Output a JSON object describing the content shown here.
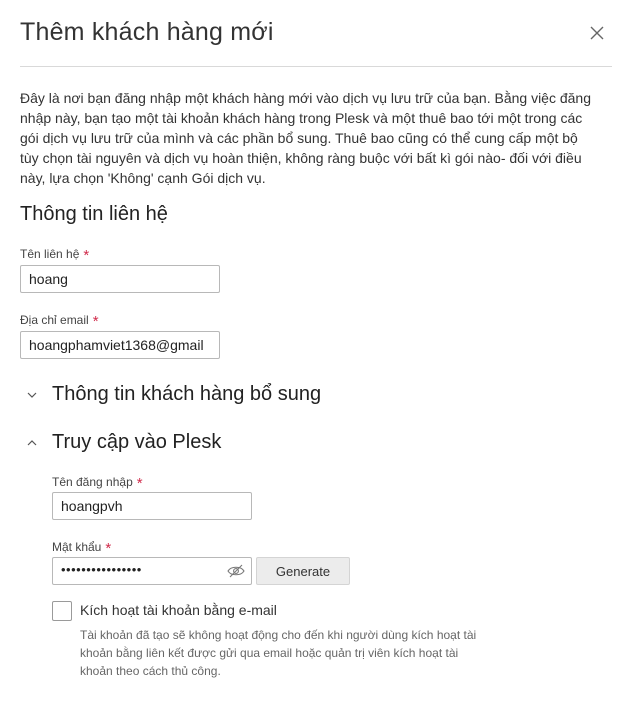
{
  "dialog": {
    "title": "Thêm khách hàng mới",
    "intro": "Đây là nơi bạn đăng nhập một khách hàng mới vào dịch vụ lưu trữ của bạn. Bằng việc đăng nhập này, bạn tạo một tài khoản khách hàng trong Plesk và một thuê bao tới một trong các gói dịch vụ lưu trữ của mình và các phần bổ sung. Thuê bao cũng có thể cung cấp một bộ tùy chọn tài nguyên và dịch vụ hoàn thiện, không ràng buộc với bất kì gói nào- đối với điều này, lựa chọn 'Không' cạnh Gói dịch vụ."
  },
  "contact": {
    "heading": "Thông tin liên hệ",
    "name_label": "Tên liên hệ",
    "name_value": "hoang",
    "email_label": "Địa chỉ email",
    "email_value": "hoangphamviet1368@gmail"
  },
  "additional_info": {
    "label": "Thông tin khách hàng bổ sung",
    "expanded": false
  },
  "plesk_access": {
    "label": "Truy cập vào Plesk",
    "expanded": true,
    "username_label": "Tên đăng nhập",
    "username_value": "hoangpvh",
    "password_label": "Mật khẩu",
    "password_masked": "••••••••••••••••",
    "generate_label": "Generate",
    "activate_label": "Kích hoạt tài khoản bằng e-mail",
    "activate_checked": false,
    "activate_hint": "Tài khoản đã tạo sẽ không hoạt động cho đến khi người dùng kích hoạt tài khoản bằng liên kết được gửi qua email hoặc quản trị viên kích hoạt tài khoản theo cách thủ công."
  },
  "required_marker": "*",
  "icons": {
    "close": "close-icon",
    "chevron_collapsed": "chevron-down-icon",
    "chevron_expanded": "chevron-up-icon",
    "eye": "eye-off-icon"
  },
  "colors": {
    "required": "#d02b4b",
    "border": "#b8b8b8",
    "button_bg": "#ececec"
  }
}
